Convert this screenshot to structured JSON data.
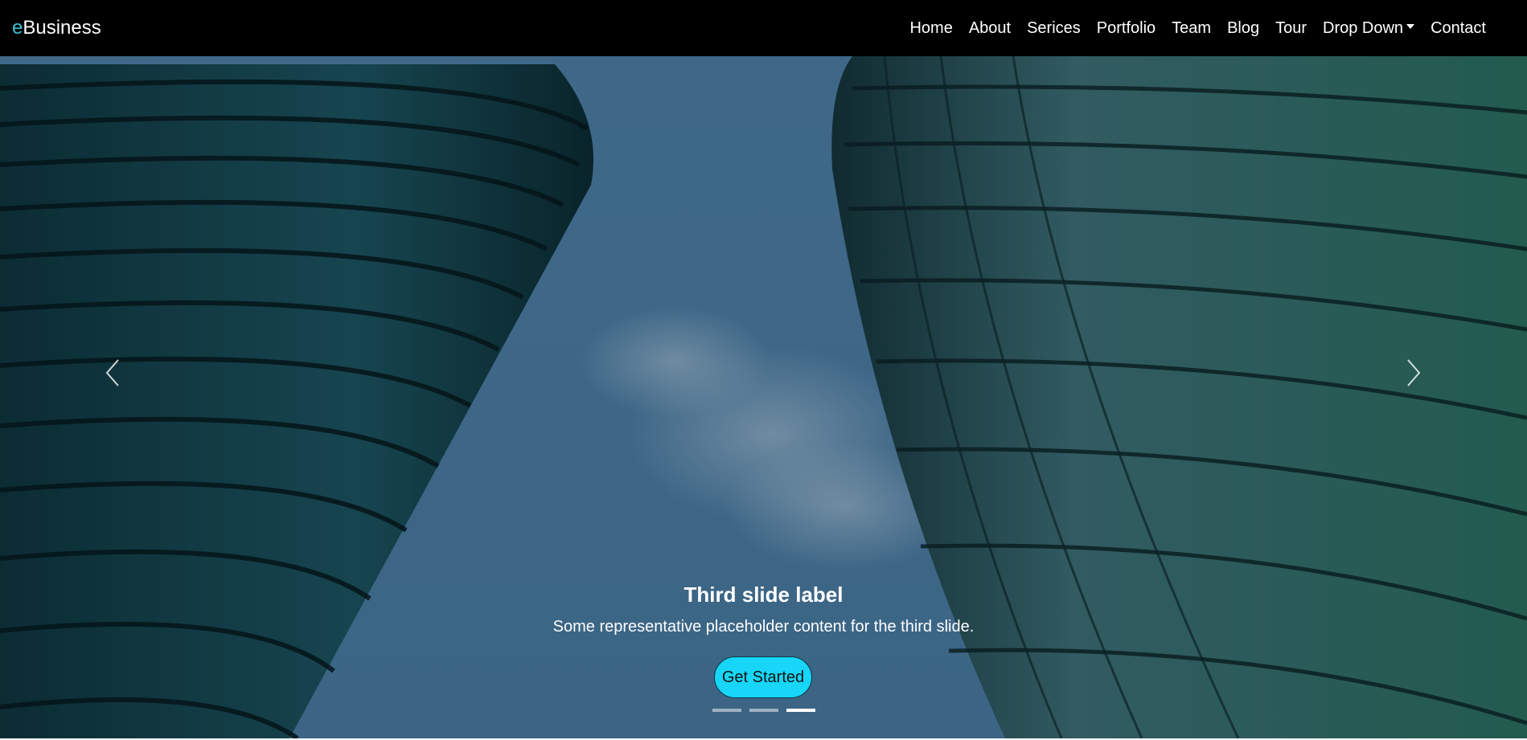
{
  "brand": {
    "accent": "e",
    "rest": "Business"
  },
  "nav": [
    {
      "label": "Home"
    },
    {
      "label": "About"
    },
    {
      "label": "Serices"
    },
    {
      "label": "Portfolio"
    },
    {
      "label": "Team"
    },
    {
      "label": "Blog"
    },
    {
      "label": "Tour"
    },
    {
      "label": "Drop Down",
      "dropdown": true
    },
    {
      "label": "Contact"
    }
  ],
  "hero": {
    "title": "Third slide label",
    "text": "Some representative placeholder content for the third slide.",
    "button": "Get Started",
    "slide_count": 3,
    "active_slide": 3
  },
  "colors": {
    "navbar": "#000000",
    "brand_accent": "#3ec1d5",
    "button": "#17d6f8"
  },
  "icons": [
    "chevron-left-icon",
    "chevron-right-icon",
    "caret-down-icon"
  ]
}
